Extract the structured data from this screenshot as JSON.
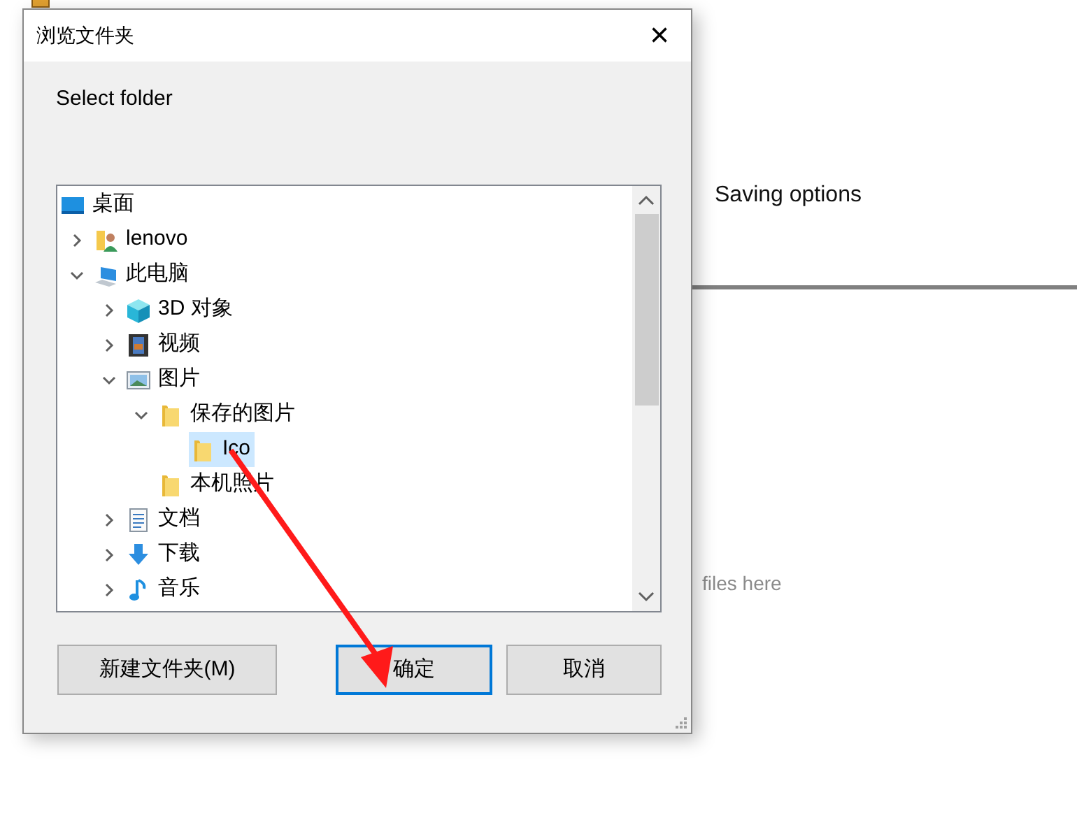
{
  "background_app": {
    "section_heading": "Saving options",
    "drop_hint": "files here"
  },
  "dialog": {
    "title": "浏览文件夹",
    "close": "×",
    "description": "Select folder",
    "tree": [
      {
        "label": "桌面",
        "kind": "desktop",
        "selected": false,
        "children": [
          {
            "label": "lenovo",
            "kind": "user-folder",
            "expanded": false,
            "selected": false
          },
          {
            "label": "此电脑",
            "kind": "computer",
            "expanded": true,
            "selected": false,
            "children": [
              {
                "label": "3D 对象",
                "kind": "cube",
                "expanded": false,
                "selected": false
              },
              {
                "label": "视频",
                "kind": "film",
                "expanded": false,
                "selected": false
              },
              {
                "label": "图片",
                "kind": "picture",
                "expanded": true,
                "selected": false,
                "children": [
                  {
                    "label": "保存的图片",
                    "kind": "folder",
                    "expanded": true,
                    "selected": false,
                    "children": [
                      {
                        "label": "Ico",
                        "kind": "folder",
                        "selected": true
                      }
                    ]
                  },
                  {
                    "label": "本机照片",
                    "kind": "folder",
                    "selected": false
                  }
                ]
              },
              {
                "label": "文档",
                "kind": "document",
                "expanded": false,
                "selected": false
              },
              {
                "label": "下载",
                "kind": "download",
                "expanded": false,
                "selected": false
              },
              {
                "label": "音乐",
                "kind": "music",
                "expanded": false,
                "selected": false
              }
            ]
          }
        ]
      }
    ],
    "buttons": [
      {
        "label": "新建文件夹(M)",
        "default": false
      },
      {
        "label": "确定",
        "default": true
      },
      {
        "label": "取消",
        "default": false
      }
    ]
  }
}
